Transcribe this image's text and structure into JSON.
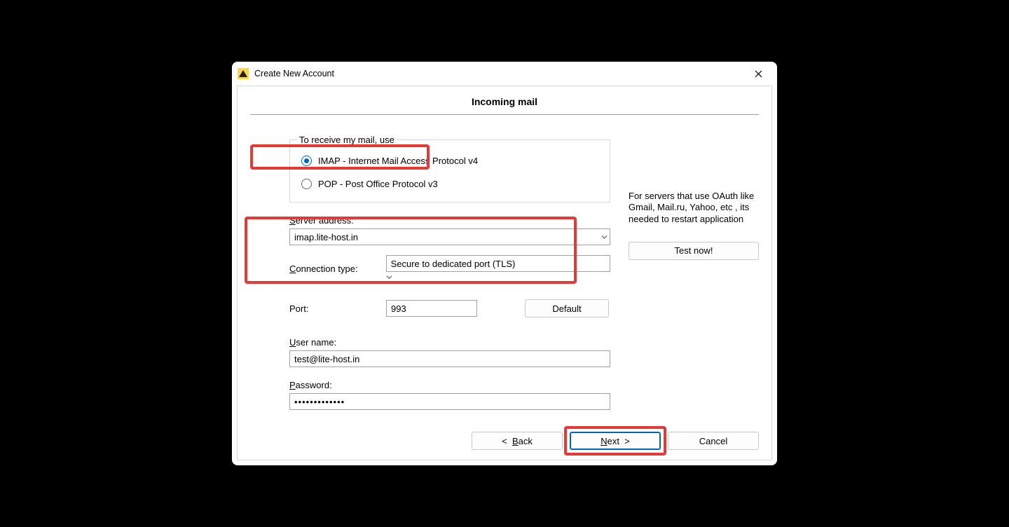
{
  "window": {
    "title": "Create New Account",
    "page_heading": "Incoming mail"
  },
  "protocol": {
    "legend": "To receive my mail, use",
    "imap_label": "IMAP - Internet Mail Access Protocol v4",
    "pop_label": "POP  -  Post Office Protocol v3",
    "selected": "imap"
  },
  "server": {
    "label": "Server address:",
    "value": "imap.lite-host.in"
  },
  "connection": {
    "label": "Connection type:",
    "value": "Secure to dedicated port (TLS)"
  },
  "port": {
    "label": "Port:",
    "value": "993",
    "default_button": "Default"
  },
  "user": {
    "label": "User name:",
    "value": "test@lite-host.in"
  },
  "password": {
    "label": "Password:",
    "value": "•••••••••••••"
  },
  "sidebar": {
    "oauth_note": "For servers that use OAuth like Gmail, Mail.ru, Yahoo, etc , its needed to restart application",
    "test_button": "Test now!"
  },
  "nav": {
    "back": "<  Back",
    "next": "Next  >",
    "cancel": "Cancel"
  }
}
